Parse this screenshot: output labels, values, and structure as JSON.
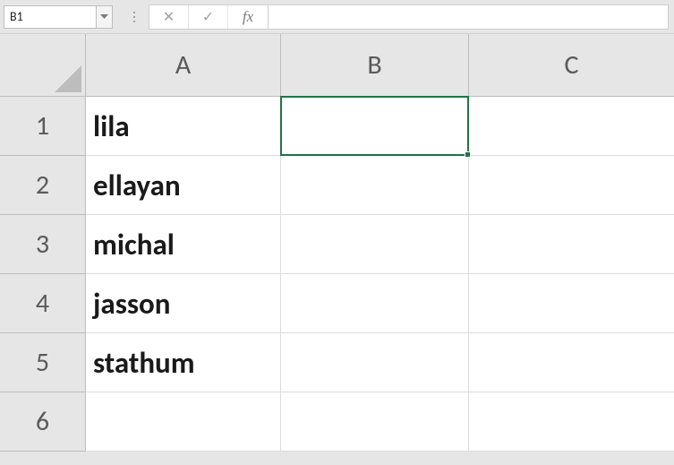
{
  "formula_bar": {
    "name_box": "B1",
    "cancel_glyph": "✕",
    "enter_glyph": "✓",
    "fx_label": "fx",
    "formula_value": ""
  },
  "columns": [
    "A",
    "B",
    "C"
  ],
  "rows": [
    "1",
    "2",
    "3",
    "4",
    "5",
    "6"
  ],
  "cells": {
    "A1": "lila",
    "A2": "ellayan",
    "A3": "michal",
    "A4": "jasson",
    "A5": "stathum",
    "A6": "",
    "B1": "",
    "B2": "",
    "B3": "",
    "B4": "",
    "B5": "",
    "B6": "",
    "C1": "",
    "C2": "",
    "C3": "",
    "C4": "",
    "C5": "",
    "C6": ""
  },
  "selection": {
    "cell": "B1"
  },
  "colors": {
    "selection_border": "#217346"
  }
}
